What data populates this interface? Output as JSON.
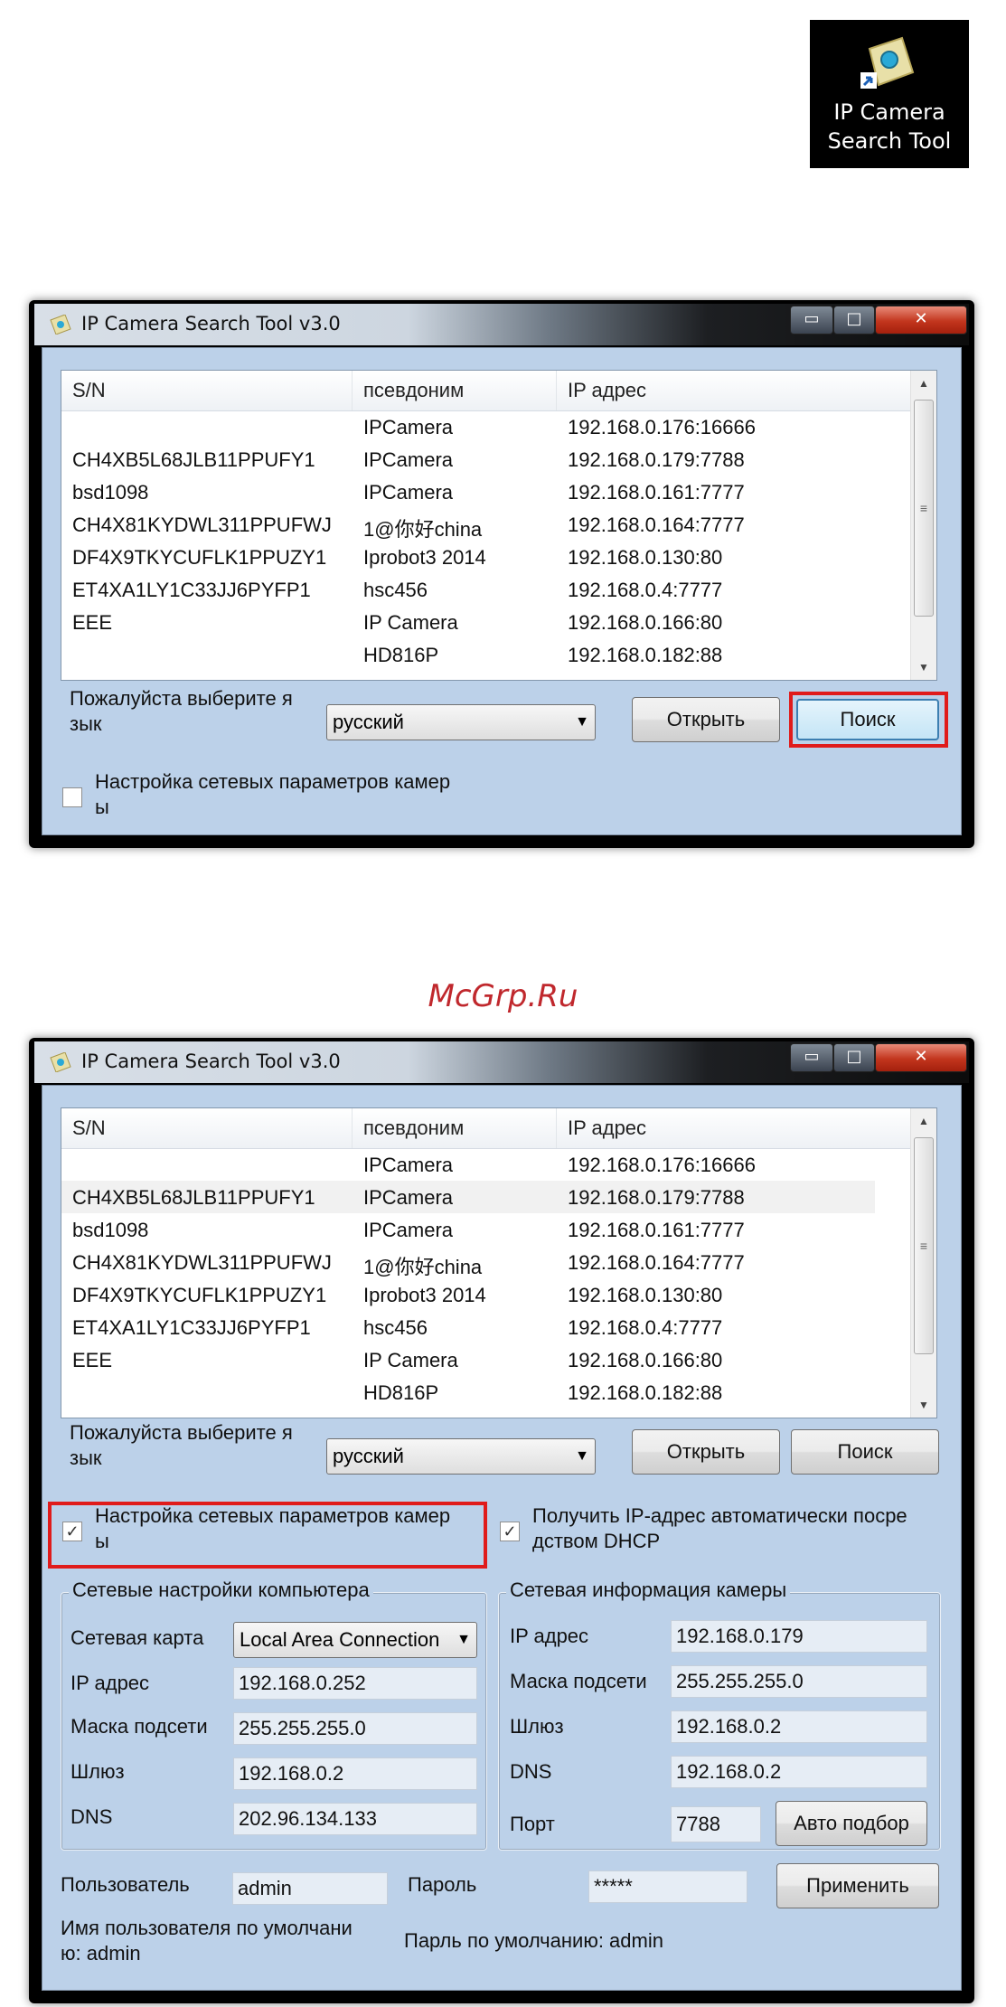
{
  "desktop_icon": {
    "label_line1": "IP Camera",
    "label_line2": "Search Tool"
  },
  "watermark": "McGrp.Ru",
  "window": {
    "title": "IP Camera Search Tool  v3.0",
    "controls": {
      "minimize": "▭",
      "maximize": "□",
      "close": "✕"
    }
  },
  "list": {
    "headers": [
      "S/N",
      "псевдоним",
      "IP адрес"
    ],
    "rows": [
      [
        "",
        "IPCamera",
        "192.168.0.176:16666"
      ],
      [
        "CH4XB5L68JLB11PPUFY1",
        "IPCamera",
        "192.168.0.179:7788"
      ],
      [
        "bsd1098",
        "IPCamera",
        "192.168.0.161:7777"
      ],
      [
        "CH4X81KYDWL311PPUFWJ",
        "1@你好china",
        "192.168.0.164:7777"
      ],
      [
        "DF4X9TKYCUFLK1PPUZY1",
        "Iprobot3 2014",
        "192.168.0.130:80"
      ],
      [
        "ET4XA1LY1C33JJ6PYFP1",
        "hsc456",
        "192.168.0.4:7777"
      ],
      [
        "EEE",
        "IP Camera",
        "192.168.0.166:80"
      ],
      [
        "",
        "HD816P",
        "192.168.0.182:88"
      ]
    ]
  },
  "language_label_1": "Пожалуйста выберите я",
  "language_label_2": "зык",
  "language_value": "русский",
  "open_button": "Открыть",
  "search_button": "Поиск",
  "net_settings_check_1": "Настройка сетевых параметров камер",
  "net_settings_check_2": "ы",
  "dhcp_check_1": "Получить IP-адрес автоматически посре",
  "dhcp_check_2": "дством DHCP",
  "pc_group": {
    "title": "Сетевые настройки компьютера",
    "adapter_label": "Сетевая карта",
    "adapter_value": "Local Area Connection",
    "ip_label": "IP адрес",
    "ip_value": "192.168.0.252",
    "mask_label": "Маска подсети",
    "mask_value": "255.255.255.0",
    "gateway_label": "Шлюз",
    "gateway_value": "192.168.0.2",
    "dns_label": "DNS",
    "dns_value": "202.96.134.133"
  },
  "cam_group": {
    "title": "Сетевая информация камеры",
    "ip_label": "IP адрес",
    "ip_value": "192.168.0.179",
    "mask_label": "Маска подсети",
    "mask_value": "255.255.255.0",
    "gateway_label": "Шлюз",
    "gateway_value": "192.168.0.2",
    "dns_label": "DNS",
    "dns_value": "192.168.0.2",
    "port_label": "Порт",
    "port_value": "7788",
    "auto_button": "Авто подбор"
  },
  "user_label": "Пользователь",
  "user_value": "admin",
  "password_label": "Пароль",
  "password_value": "*****",
  "apply_button": "Применить",
  "default_user_1": "Имя пользователя по умолчани",
  "default_user_2": "ю: admin",
  "default_password": "Парль по умолчанию: admin"
}
